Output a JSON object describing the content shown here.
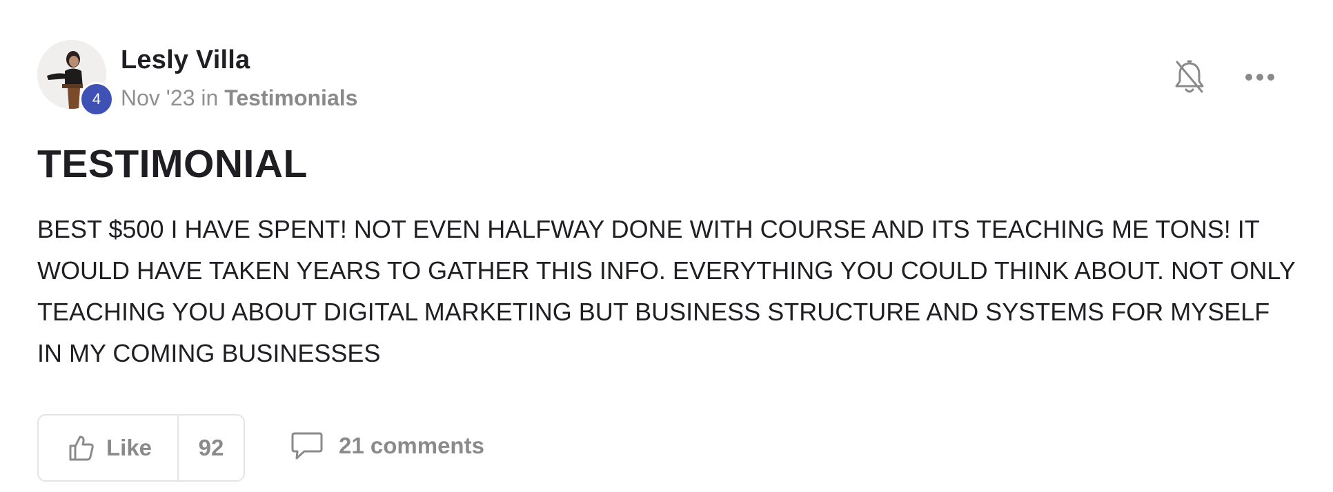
{
  "author": {
    "name": "Lesly Villa",
    "level": "4"
  },
  "meta": {
    "date": "Nov '23",
    "in_word": "in",
    "category": "Testimonials"
  },
  "post": {
    "title": "TESTIMONIAL",
    "body": "BEST $500 I HAVE SPENT! NOT EVEN HALFWAY DONE WITH COURSE AND ITS TEACHING ME TONS! IT WOULD HAVE TAKEN YEARS TO GATHER THIS INFO. EVERYTHING YOU COULD THINK ABOUT. NOT ONLY TEACHING YOU ABOUT DIGITAL MARKETING BUT BUSINESS STRUCTURE AND SYSTEMS FOR MYSELF IN MY COMING BUSINESSES"
  },
  "actions": {
    "like_label": "Like",
    "like_count": "92",
    "comments_label": "21 comments"
  },
  "icons": {
    "notification": "bell-off-icon",
    "more": "more-horizontal-icon",
    "like": "thumbs-up-icon",
    "comments": "chat-bubble-icon"
  },
  "colors": {
    "badge": "#3f51b5",
    "text_primary": "#1f1f23",
    "text_muted": "#8a8a8a",
    "border": "#e4e4e4"
  }
}
